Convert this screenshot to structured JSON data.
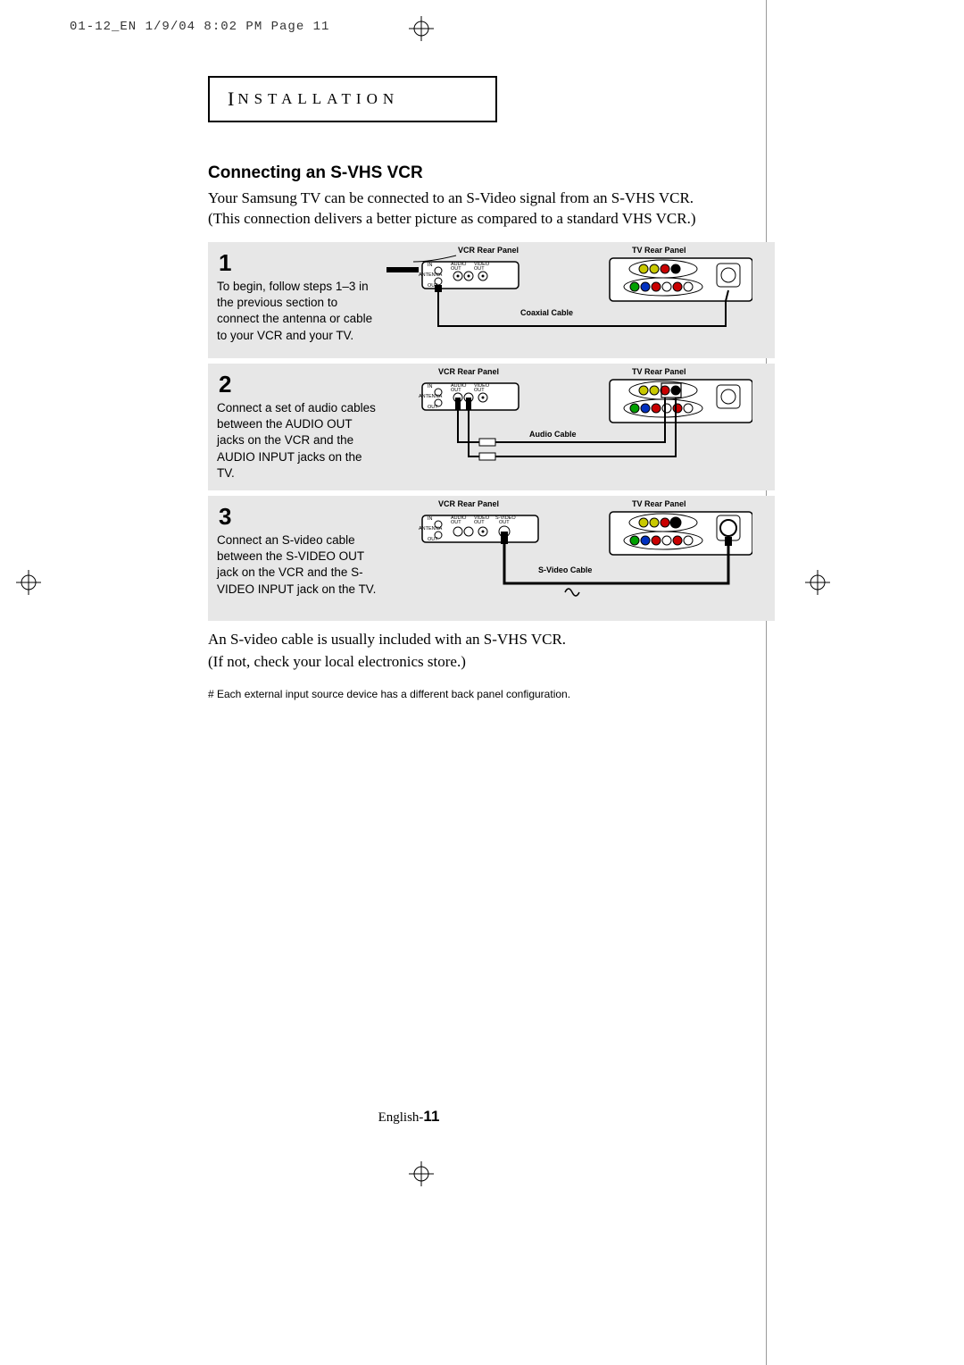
{
  "header_info": "01-12_EN  1/9/04 8:02 PM  Page 11",
  "section_label_first": "I",
  "section_label_rest": "NSTALLATION",
  "title": "Connecting an S-VHS VCR",
  "intro_line1": "Your Samsung TV can be connected to an S-Video signal from an S-VHS VCR.",
  "intro_line2": "(This connection delivers a better picture as compared to a standard VHS VCR.)",
  "steps": [
    {
      "num": "1",
      "text": "To begin, follow steps 1–3 in the previous section to connect the antenna or cable to your VCR and your TV.",
      "labels": {
        "vcr": "VCR Rear Panel",
        "tv": "TV Rear Panel",
        "cable": "Coaxial Cable"
      }
    },
    {
      "num": "2",
      "text": "Connect a set of audio cables between the AUDIO OUT jacks on the  VCR and the AUDIO INPUT jacks on the TV.",
      "labels": {
        "vcr": "VCR Rear Panel",
        "tv": "TV Rear Panel",
        "cable": "Audio Cable"
      }
    },
    {
      "num": "3",
      "text": "Connect an S-video cable between the S-VIDEO OUT jack on the VCR and the S-VIDEO INPUT jack on the TV.",
      "labels": {
        "vcr": "VCR Rear Panel",
        "tv": "TV Rear Panel",
        "cable": "S-Video Cable"
      }
    }
  ],
  "after_steps_line1": "An S-video cable is usually included with an S-VHS VCR.",
  "after_steps_line2": "(If not, check your local electronics store.)",
  "footnote": "# Each external input source device has a different back panel configuration.",
  "footer_label": "English-",
  "footer_page": "11",
  "diagram_common": {
    "in": "IN",
    "out": "OUT",
    "antenna": "ANTENNA",
    "audio_out": "AUDIO OUT",
    "video_out": "VIDEO OUT",
    "svideo_out": "S-VIDEO OUT"
  }
}
